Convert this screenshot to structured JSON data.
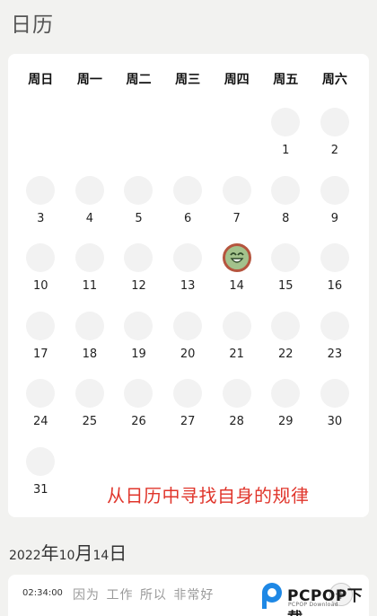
{
  "page": {
    "title": "日历"
  },
  "calendar": {
    "weekdays": [
      "周日",
      "周一",
      "周二",
      "周三",
      "周四",
      "周五",
      "周六"
    ],
    "days": [
      "1",
      "2",
      "3",
      "4",
      "5",
      "6",
      "7",
      "8",
      "9",
      "10",
      "11",
      "12",
      "13",
      "14",
      "15",
      "16",
      "17",
      "18",
      "19",
      "20",
      "21",
      "22",
      "23",
      "24",
      "25",
      "26",
      "27",
      "28",
      "29",
      "30",
      "31"
    ],
    "first_weekday_index": 5,
    "mood_day": 14,
    "tagline": "从日历中寻找自身的规律"
  },
  "entry": {
    "date_parts": [
      "2022",
      "年",
      "10",
      "月",
      "14",
      "日"
    ],
    "time": "02:34:00",
    "text": "因为 工作 所以 非常好"
  },
  "watermark": {
    "brand": "PCPOP下载",
    "sub": "PCPOP Download"
  },
  "colors": {
    "tagline": "#e0352b",
    "mood_fill": "#a3c28c",
    "mood_ring": "#b5553e"
  },
  "icons": [
    "happy-face-icon",
    "add-icon",
    "pcpop-logo-icon"
  ]
}
